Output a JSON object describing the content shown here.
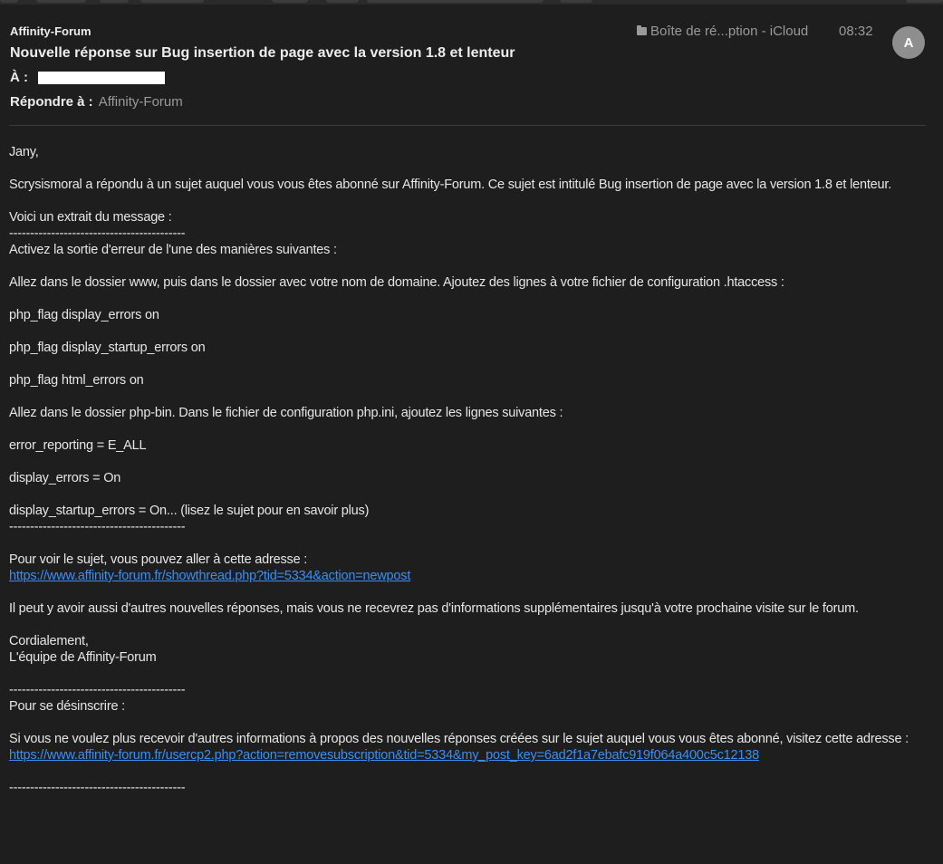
{
  "header": {
    "sender": "Affinity-Forum",
    "subject": "Nouvelle réponse sur Bug insertion de page avec la version 1.8 et lenteur",
    "to_label": "À :",
    "reply_label": "Répondre à :",
    "reply_value": "Affinity-Forum",
    "mailbox": "Boîte de ré...ption - iCloud",
    "time": "08:32",
    "avatar_initial": "A"
  },
  "body": {
    "greeting": "Jany,",
    "intro": "Scrysismoral a répondu à un sujet auquel vous vous êtes abonné sur Affinity-Forum. Ce sujet est intitulé Bug insertion de page avec la version 1.8 et lenteur.",
    "excerpt_label": "Voici un extrait du message :",
    "separator": "------------------------------------------",
    "lines": [
      "Activez la sortie d'erreur de l'une des manières suivantes :",
      "Allez dans le dossier www, puis dans le dossier avec votre nom de domaine. Ajoutez des lignes à votre fichier de configuration .htaccess :",
      "php_flag display_errors on",
      "php_flag display_startup_errors on",
      "php_flag html_errors on",
      "Allez dans le dossier php-bin. Dans le fichier de configuration php.ini, ajoutez les lignes suivantes :",
      "error_reporting = E_ALL",
      "display_errors = On",
      "display_startup_errors = On... (lisez le sujet pour en savoir plus)"
    ],
    "view_label": "Pour voir le sujet, vous pouvez aller à cette adresse :",
    "view_link": "https://www.affinity-forum.fr/showthread.php?tid=5334&action=newpost",
    "other_replies": "Il peut y avoir aussi d'autres nouvelles réponses, mais vous ne recevrez pas d'informations supplémentaires jusqu'à votre prochaine visite sur le forum.",
    "regards": "Cordialement,",
    "team": "L'équipe de Affinity-Forum",
    "unsub_label": "Pour se désinscrire :",
    "unsub_text": "Si vous ne voulez plus recevoir d'autres informations à propos des nouvelles réponses créées sur le sujet auquel vous vous êtes abonné, visitez cette adresse :",
    "unsub_link": "https://www.affinity-forum.fr/usercp2.php?action=removesubscription&tid=5334&my_post_key=6ad2f1a7ebafc919f064a400c5c12138"
  },
  "colors": {
    "background": "#1e1e1e",
    "link": "#3b8ff3",
    "muted": "#9a9a9a"
  }
}
